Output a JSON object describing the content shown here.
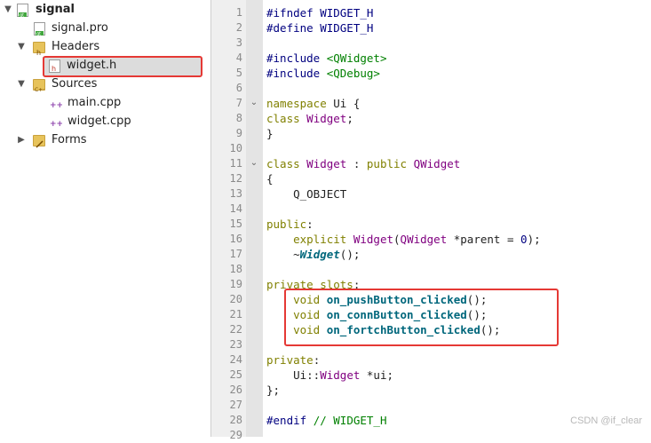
{
  "tree": {
    "project": "signal",
    "pro_file": "signal.pro",
    "headers_label": "Headers",
    "header_file": "widget.h",
    "sources_label": "Sources",
    "source_files": [
      "main.cpp",
      "widget.cpp"
    ],
    "forms_label": "Forms"
  },
  "editor": {
    "lines": [
      {
        "n": "1"
      },
      {
        "n": "2"
      },
      {
        "n": "3"
      },
      {
        "n": "4"
      },
      {
        "n": "5"
      },
      {
        "n": "6"
      },
      {
        "n": "7"
      },
      {
        "n": "8"
      },
      {
        "n": "9"
      },
      {
        "n": "10"
      },
      {
        "n": "11"
      },
      {
        "n": "12"
      },
      {
        "n": "13"
      },
      {
        "n": "14"
      },
      {
        "n": "15"
      },
      {
        "n": "16"
      },
      {
        "n": "17"
      },
      {
        "n": "18"
      },
      {
        "n": "19"
      },
      {
        "n": "20"
      },
      {
        "n": "21"
      },
      {
        "n": "22"
      },
      {
        "n": "23"
      },
      {
        "n": "24"
      },
      {
        "n": "25"
      },
      {
        "n": "26"
      },
      {
        "n": "27"
      },
      {
        "n": "28"
      },
      {
        "n": "29"
      }
    ],
    "code": {
      "l1_a": "#ifndef WIDGET_H",
      "l2_a": "#define WIDGET_H",
      "l4_a": "#include ",
      "l4_b": "<QWidget>",
      "l5_a": "#include ",
      "l5_b": "<QDebug>",
      "l7_a": "namespace",
      "l7_b": " Ui {",
      "l8_a": "class",
      "l8_b": " ",
      "l8_c": "Widget",
      ";": ";",
      "l9_a": "}",
      "l11_a": "class",
      "l11_b": " ",
      "l11_c": "Widget",
      " : ": " : ",
      "l11_d": "public",
      "l11_e": " ",
      "l11_f": "QWidget",
      "l12_a": "{",
      "l13_a": "    Q_OBJECT",
      "l15_a": "public",
      ":": ":",
      "l16_a": "    ",
      "l16_b": "explicit",
      "l16_c": " ",
      "l16_d": "Widget",
      "l16_e": "(",
      "l16_f": "QWidget",
      "l16_g": " *parent = ",
      "l16_h": "0",
      "l16_i": ");",
      "l17_a": "    ~",
      "l17_b": "Widget",
      "l17_c": "();",
      "l19_a": "private slots",
      "l20_a": "    ",
      "l20_b": "void",
      "l20_c": " ",
      "l20_d": "on_pushButton_clicked",
      "l20_e": "();",
      "l21_a": "    ",
      "l21_b": "void",
      "l21_c": " ",
      "l21_d": "on_connButton_clicked",
      "l21_e": "();",
      "l22_a": "    ",
      "l22_b": "void",
      "l22_c": " ",
      "l22_d": "on_fortchButton_clicked",
      "l22_e": "();",
      "l24_a": "private",
      "l25_a": "    Ui::",
      "l25_b": "Widget",
      "l25_c": " *ui;",
      "l26_a": "};",
      "l28_a": "#endif ",
      "l28_b": "// WIDGET_H"
    }
  },
  "watermark": "CSDN @if_clear"
}
